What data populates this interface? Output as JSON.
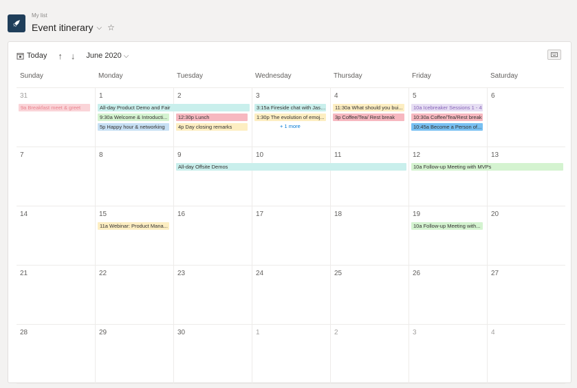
{
  "header": {
    "list_name": "My list",
    "title": "Event itinerary"
  },
  "toolbar": {
    "today_label": "Today",
    "month_label": "June 2020"
  },
  "days_of_week": [
    "Sunday",
    "Monday",
    "Tuesday",
    "Wednesday",
    "Thursday",
    "Friday",
    "Saturday"
  ],
  "weeks": [
    [
      "31",
      "1",
      "2",
      "3",
      "4",
      "5",
      "6"
    ],
    [
      "7",
      "8",
      "9",
      "10",
      "11",
      "12",
      "13"
    ],
    [
      "14",
      "15",
      "16",
      "17",
      "18",
      "19",
      "20"
    ],
    [
      "21",
      "22",
      "23",
      "24",
      "25",
      "26",
      "27"
    ],
    [
      "28",
      "29",
      "30",
      "1",
      "2",
      "3",
      "4"
    ]
  ],
  "events": {
    "e1": "9a Breakfast meet & greet",
    "e2": "All-day Product Demo and Fair",
    "e3": "9:30a Welcome & Introducti...",
    "e4": "5p Happy hour & networking",
    "e5": "12:30p Lunch",
    "e6": "4p Day closing remarks",
    "e7": "3:15a Fireside chat with Jason",
    "e8": "1:30p The evolution of emoj...",
    "e9": "11:30a What should you bui...",
    "e10": "3p Coffee/Tea/ Rest break",
    "e11": "10a Icebreaker Sessions 1 - 4",
    "e12": "10:30a Coffee/Tea/Rest break",
    "e13": "10:45a Become a Person of...",
    "e14": "All-day Offsite Demos",
    "e15": "10a Follow-up Meeting with MVPs",
    "e16": "11a Webinar: Product Mana...",
    "e17": "10a Follow-up Meeting with..."
  },
  "more_link": "+ 1 more",
  "colors": {
    "pink": "#fad4d8",
    "pink_text": "#e8838e",
    "teal": "#c9efec",
    "green": "#d4f3d0",
    "blue": "#c7e0f4",
    "red": "#f7b8c0",
    "yellow": "#fdeec2",
    "lavender": "#e6def3",
    "bright_blue": "#78c0f2",
    "brand": "#1f3e5a"
  }
}
